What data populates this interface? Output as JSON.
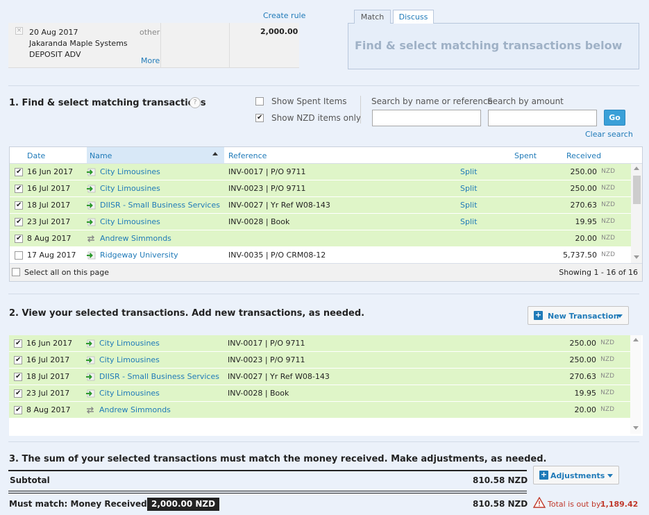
{
  "statement": {
    "date": "20 Aug 2017",
    "type": "other",
    "payee": "Jakaranda Maple Systems",
    "reference": "DEPOSIT ADV",
    "more_label": "More",
    "amount": "2,000.00",
    "create_rule_label": "Create rule"
  },
  "tabs": {
    "match": "Match",
    "discuss": "Discuss"
  },
  "hint": "Find & select matching transactions below",
  "section1": {
    "title": "1. Find & select matching transactions",
    "help": "?",
    "show_spent_label": "Show Spent Items",
    "show_spent_checked": false,
    "show_nzd_label": "Show NZD items only",
    "show_nzd_checked": true,
    "search_name_label": "Search by name or reference",
    "search_amount_label": "Search by amount",
    "search_name_value": "",
    "search_amount_value": "",
    "go_label": "Go",
    "clear_search_label": "Clear search"
  },
  "table1": {
    "headers": {
      "date": "Date",
      "name": "Name",
      "reference": "Reference",
      "spent": "Spent",
      "received": "Received"
    },
    "rows": [
      {
        "checked": true,
        "date": "16 Jun 2017",
        "icon": "arrow-right-icon",
        "name": "City Limousines",
        "reference": "INV-0017 | P/O 9711",
        "split": "Split",
        "amount": "250.00",
        "currency": "NZD"
      },
      {
        "checked": true,
        "date": "16 Jul 2017",
        "icon": "arrow-right-icon",
        "name": "City Limousines",
        "reference": "INV-0023 | P/O 9711",
        "split": "Split",
        "amount": "250.00",
        "currency": "NZD"
      },
      {
        "checked": true,
        "date": "18 Jul 2017",
        "icon": "arrow-right-icon",
        "name": "DIISR - Small Business Services",
        "reference": "INV-0027 | Yr Ref W08-143",
        "split": "Split",
        "amount": "270.63",
        "currency": "NZD"
      },
      {
        "checked": true,
        "date": "23 Jul 2017",
        "icon": "arrow-right-icon",
        "name": "City Limousines",
        "reference": "INV-0028 | Book",
        "split": "Split",
        "amount": "19.95",
        "currency": "NZD"
      },
      {
        "checked": true,
        "date": "8 Aug 2017",
        "icon": "transfer-icon",
        "name": "Andrew Simmonds",
        "reference": "",
        "split": "",
        "amount": "20.00",
        "currency": "NZD"
      },
      {
        "checked": false,
        "date": "17 Aug 2017",
        "icon": "arrow-right-icon",
        "name": "Ridgeway University",
        "reference": "INV-0035 | P/O CRM08-12",
        "split": "",
        "amount": "5,737.50",
        "currency": "NZD"
      }
    ],
    "select_all_label": "Select all on this page",
    "showing_label": "Showing 1 - 16 of 16"
  },
  "section2": {
    "title": "2. View your selected transactions. Add new transactions, as needed.",
    "new_transaction_label": "New Transaction",
    "rows": [
      {
        "checked": true,
        "date": "16 Jun 2017",
        "icon": "arrow-right-icon",
        "name": "City Limousines",
        "reference": "INV-0017 | P/O 9711",
        "amount": "250.00",
        "currency": "NZD"
      },
      {
        "checked": true,
        "date": "16 Jul 2017",
        "icon": "arrow-right-icon",
        "name": "City Limousines",
        "reference": "INV-0023 | P/O 9711",
        "amount": "250.00",
        "currency": "NZD"
      },
      {
        "checked": true,
        "date": "18 Jul 2017",
        "icon": "arrow-right-icon",
        "name": "DIISR - Small Business Services",
        "reference": "INV-0027 | Yr Ref W08-143",
        "amount": "270.63",
        "currency": "NZD"
      },
      {
        "checked": true,
        "date": "23 Jul 2017",
        "icon": "arrow-right-icon",
        "name": "City Limousines",
        "reference": "INV-0028 | Book",
        "amount": "19.95",
        "currency": "NZD"
      },
      {
        "checked": true,
        "date": "8 Aug 2017",
        "icon": "transfer-icon",
        "name": "Andrew Simmonds",
        "reference": "",
        "amount": "20.00",
        "currency": "NZD"
      }
    ]
  },
  "section3": {
    "title": "3. The sum of your selected transactions must match the money received. Make adjustments, as needed.",
    "subtotal_label": "Subtotal",
    "subtotal_value": "810.58 NZD",
    "adjustments_label": "Adjustments",
    "must_match_label": "Must match: Money Received",
    "money_received_badge": "2,000.00 NZD",
    "must_match_value": "810.58 NZD",
    "out_by_label": "Total is out by:",
    "out_by_value": "1,189.42"
  },
  "colors": {
    "link": "#1f7ab8",
    "selected_row": "#dff5c8",
    "warning": "#c0392b",
    "go_button": "#3aa0d8"
  }
}
